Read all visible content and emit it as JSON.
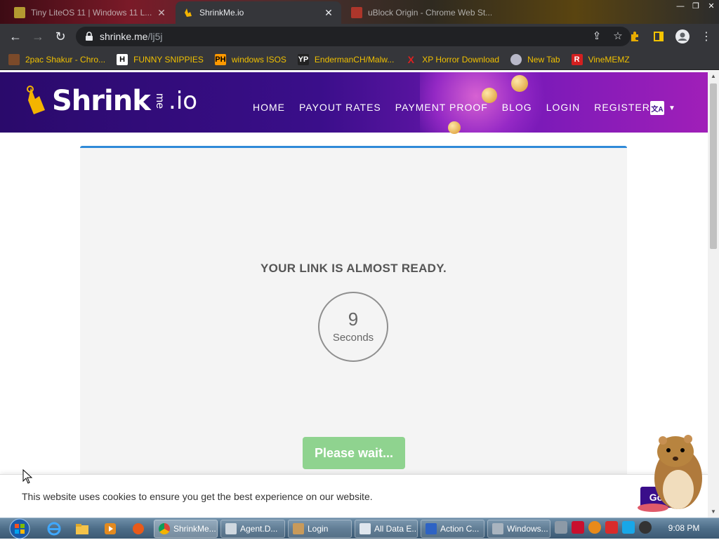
{
  "browser": {
    "tabs": [
      {
        "title": "Tiny LiteOS 11 | Windows 11 L...",
        "active": false
      },
      {
        "title": "ShrinkMe.io",
        "active": true
      },
      {
        "title": "uBlock Origin - Chrome Web St...",
        "active": false
      }
    ],
    "url_host": "shrinke.me",
    "url_path": "/lj5j",
    "bookmarks": [
      {
        "label": "2pac Shakur - Chro...",
        "icon": "tupac-icon"
      },
      {
        "label": "FUNNY SNIPPIES",
        "icon": "h-logo-icon"
      },
      {
        "label": "windows ISOS",
        "icon": "ph-logo-icon"
      },
      {
        "label": "EndermanCH/Malw...",
        "icon": "yp-logo-icon"
      },
      {
        "label": "XP Horror Download",
        "icon": "x-logo-icon"
      },
      {
        "label": "New Tab",
        "icon": "globe-icon"
      },
      {
        "label": "VineMEMZ",
        "icon": "r-logo-icon"
      }
    ]
  },
  "site": {
    "logo_main": "Shrink",
    "logo_me": "me",
    "logo_io": ".io",
    "nav": [
      "HOME",
      "PAYOUT RATES",
      "PAYMENT PROOF",
      "BLOG",
      "LOGIN",
      "REGISTER"
    ],
    "lang_glyph": "文A"
  },
  "main": {
    "heading": "YOUR LINK IS ALMOST READY.",
    "timer_value": "9",
    "timer_unit": "Seconds",
    "wait_button": "Please wait..."
  },
  "cookie": {
    "text": "This website uses cookies to ensure you get the best experience on our website.",
    "button": "Got it"
  },
  "taskbar": {
    "windows": [
      {
        "label": "ShrinkMe...",
        "active": true
      },
      {
        "label": "Agent.D...",
        "active": false
      },
      {
        "label": "Login",
        "active": false
      },
      {
        "label": "All Data E...",
        "active": false
      },
      {
        "label": "Action C...",
        "active": false
      },
      {
        "label": "Windows...",
        "active": false
      }
    ],
    "clock": "9:08 PM"
  },
  "colors": {
    "header_start": "#2a0a6b",
    "header_end": "#a01fb8",
    "card_accent": "#2f8ad8",
    "wait_button": "#8fd38f",
    "bookmark_text": "#f0c000"
  }
}
